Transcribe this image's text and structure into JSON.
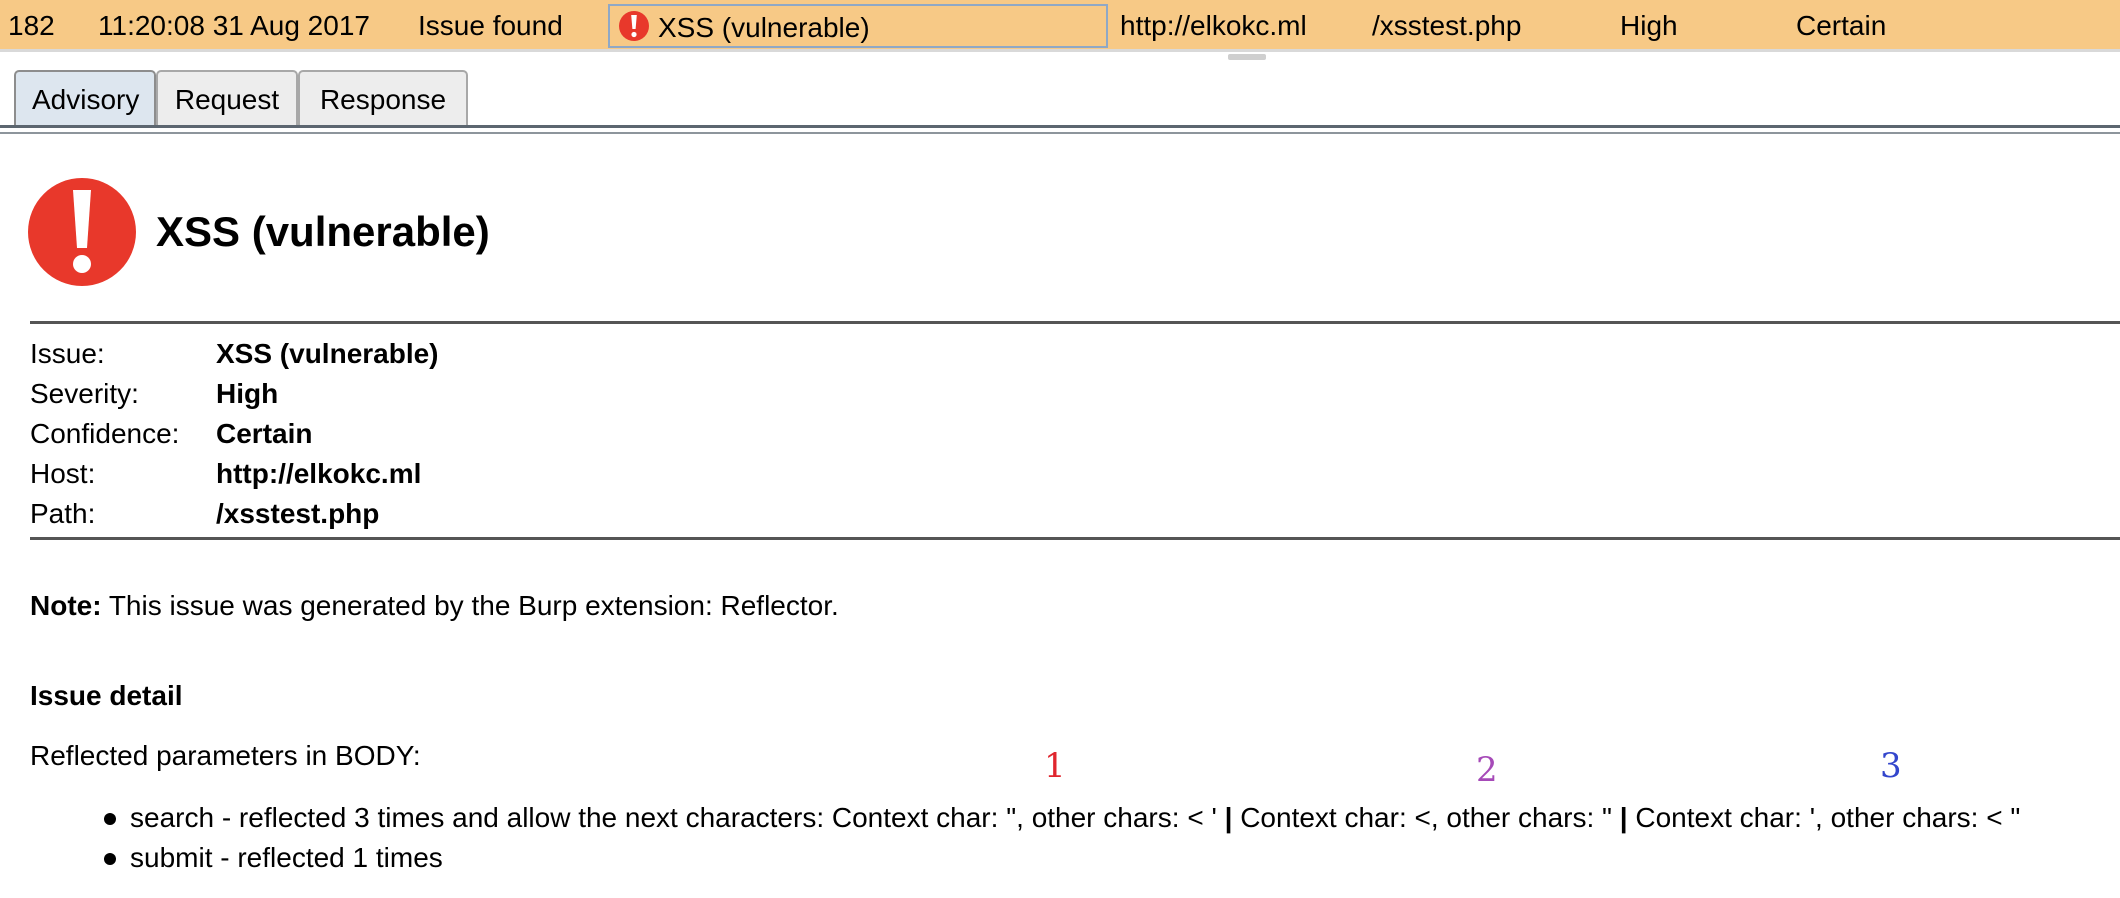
{
  "issue_row": {
    "id": "182",
    "time": "11:20:08 31 Aug 2017",
    "tool": "Issue found",
    "issue": "XSS (vulnerable)",
    "host": "http://elkokc.ml",
    "path": "/xsstest.php",
    "severity": "High",
    "confidence": "Certain",
    "icon": "alert-icon",
    "background_color": "#f7c986"
  },
  "tabs": [
    {
      "label": "Advisory",
      "active": true
    },
    {
      "label": "Request",
      "active": false
    },
    {
      "label": "Response",
      "active": false
    }
  ],
  "advisory": {
    "title": "XSS (vulnerable)",
    "icon": "alert-icon",
    "icon_color": "#e8382b",
    "details": [
      {
        "label": "Issue:",
        "value": "XSS (vulnerable)"
      },
      {
        "label": "Severity:",
        "value": "High"
      },
      {
        "label": "Confidence:",
        "value": "Certain"
      },
      {
        "label": "Host:",
        "value": "http://elkokc.ml"
      },
      {
        "label": "Path:",
        "value": "/xsstest.php"
      }
    ],
    "note_label": "Note:",
    "note_text": "This issue was generated by the Burp extension: Reflector.",
    "issue_detail_heading": "Issue detail",
    "reflected_intro": "Reflected parameters in BODY:",
    "parameters": {
      "search": {
        "text": "search - reflected 3 times and allow the next characters: Context char: \", other chars: < '",
        "separator": "|",
        "text2": "Context char: <, other chars: \"",
        "text3": "Context char: ', other chars: < \""
      },
      "submit": {
        "text": "submit - reflected 1 times"
      }
    },
    "annotations": [
      {
        "label": "1",
        "color": "#e0262e"
      },
      {
        "label": "2",
        "color": "#a64ab8"
      },
      {
        "label": "3",
        "color": "#3346cc"
      }
    ]
  }
}
